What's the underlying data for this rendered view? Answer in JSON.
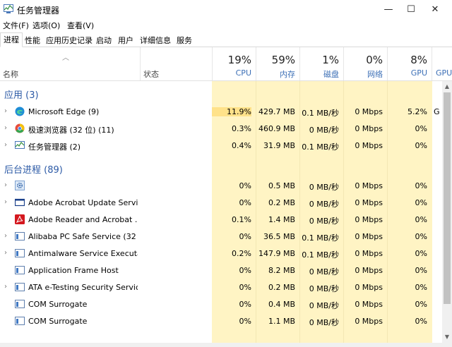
{
  "window": {
    "title": "任务管理器",
    "controls": [
      "—",
      "☐",
      "✕"
    ]
  },
  "menu": [
    "文件(F)",
    "选项(O)",
    "查看(V)"
  ],
  "tabs": [
    "进程",
    "性能",
    "应用历史记录",
    "启动",
    "用户",
    "详细信息",
    "服务"
  ],
  "columns": {
    "name": "名称",
    "status": "状态",
    "cpu": {
      "pct": "19%",
      "label": "CPU"
    },
    "mem": {
      "pct": "59%",
      "label": "内存"
    },
    "disk": {
      "pct": "1%",
      "label": "磁盘"
    },
    "net": {
      "pct": "0%",
      "label": "网络"
    },
    "gpu": {
      "pct": "8%",
      "label": "GPU"
    },
    "gpu2": {
      "label": "GPU"
    }
  },
  "groups": {
    "apps": "应用 (3)",
    "background": "后台进程 (89)"
  },
  "apps": [
    {
      "name": "Microsoft Edge (9)",
      "icon": "edge-icon",
      "cpu": "11.9%",
      "mem": "429.7 MB",
      "disk": "0.1 MB/秒",
      "net": "0 Mbps",
      "gpu": "5.2%",
      "gpu2": "G"
    },
    {
      "name": "极速浏览器 (32 位) (11)",
      "icon": "browser-icon",
      "cpu": "0.3%",
      "mem": "460.9 MB",
      "disk": "0 MB/秒",
      "net": "0 Mbps",
      "gpu": "0%",
      "gpu2": ""
    },
    {
      "name": "任务管理器 (2)",
      "icon": "task-manager-icon",
      "cpu": "0.4%",
      "mem": "31.9 MB",
      "disk": "0.1 MB/秒",
      "net": "0 Mbps",
      "gpu": "0%",
      "gpu2": ""
    }
  ],
  "background": [
    {
      "name": "",
      "icon": "gear-icon",
      "expand": true,
      "cpu": "0%",
      "mem": "0.5 MB",
      "disk": "0 MB/秒",
      "net": "0 Mbps",
      "gpu": "0%"
    },
    {
      "name": "Adobe Acrobat Update Servi...",
      "icon": "window-icon",
      "expand": true,
      "cpu": "0%",
      "mem": "0.2 MB",
      "disk": "0 MB/秒",
      "net": "0 Mbps",
      "gpu": "0%"
    },
    {
      "name": "Adobe Reader and Acrobat ...",
      "icon": "acrobat-icon",
      "expand": false,
      "cpu": "0.1%",
      "mem": "1.4 MB",
      "disk": "0 MB/秒",
      "net": "0 Mbps",
      "gpu": "0%"
    },
    {
      "name": "Alibaba PC Safe Service (32 ...",
      "icon": "service-icon",
      "expand": true,
      "cpu": "0%",
      "mem": "36.5 MB",
      "disk": "0.1 MB/秒",
      "net": "0 Mbps",
      "gpu": "0%"
    },
    {
      "name": "Antimalware Service Executa...",
      "icon": "service-icon",
      "expand": true,
      "cpu": "0.2%",
      "mem": "147.9 MB",
      "disk": "0.1 MB/秒",
      "net": "0 Mbps",
      "gpu": "0%"
    },
    {
      "name": "Application Frame Host",
      "icon": "service-icon",
      "expand": false,
      "cpu": "0%",
      "mem": "8.2 MB",
      "disk": "0 MB/秒",
      "net": "0 Mbps",
      "gpu": "0%"
    },
    {
      "name": "ATA e-Testing Security Servic...",
      "icon": "service-icon",
      "expand": true,
      "cpu": "0%",
      "mem": "0.2 MB",
      "disk": "0 MB/秒",
      "net": "0 Mbps",
      "gpu": "0%"
    },
    {
      "name": "COM Surrogate",
      "icon": "service-icon",
      "expand": false,
      "cpu": "0%",
      "mem": "0.4 MB",
      "disk": "0 MB/秒",
      "net": "0 Mbps",
      "gpu": "0%"
    },
    {
      "name": "COM Surrogate",
      "icon": "service-icon",
      "expand": false,
      "cpu": "0%",
      "mem": "1.1 MB",
      "disk": "0 MB/秒",
      "net": "0 Mbps",
      "gpu": "0%"
    }
  ],
  "colors": {
    "heat_light": "#fff4c4",
    "heat_mid": "#ffe9a0",
    "group_title": "#2c5aa6",
    "header_label": "#3c6fb6"
  }
}
